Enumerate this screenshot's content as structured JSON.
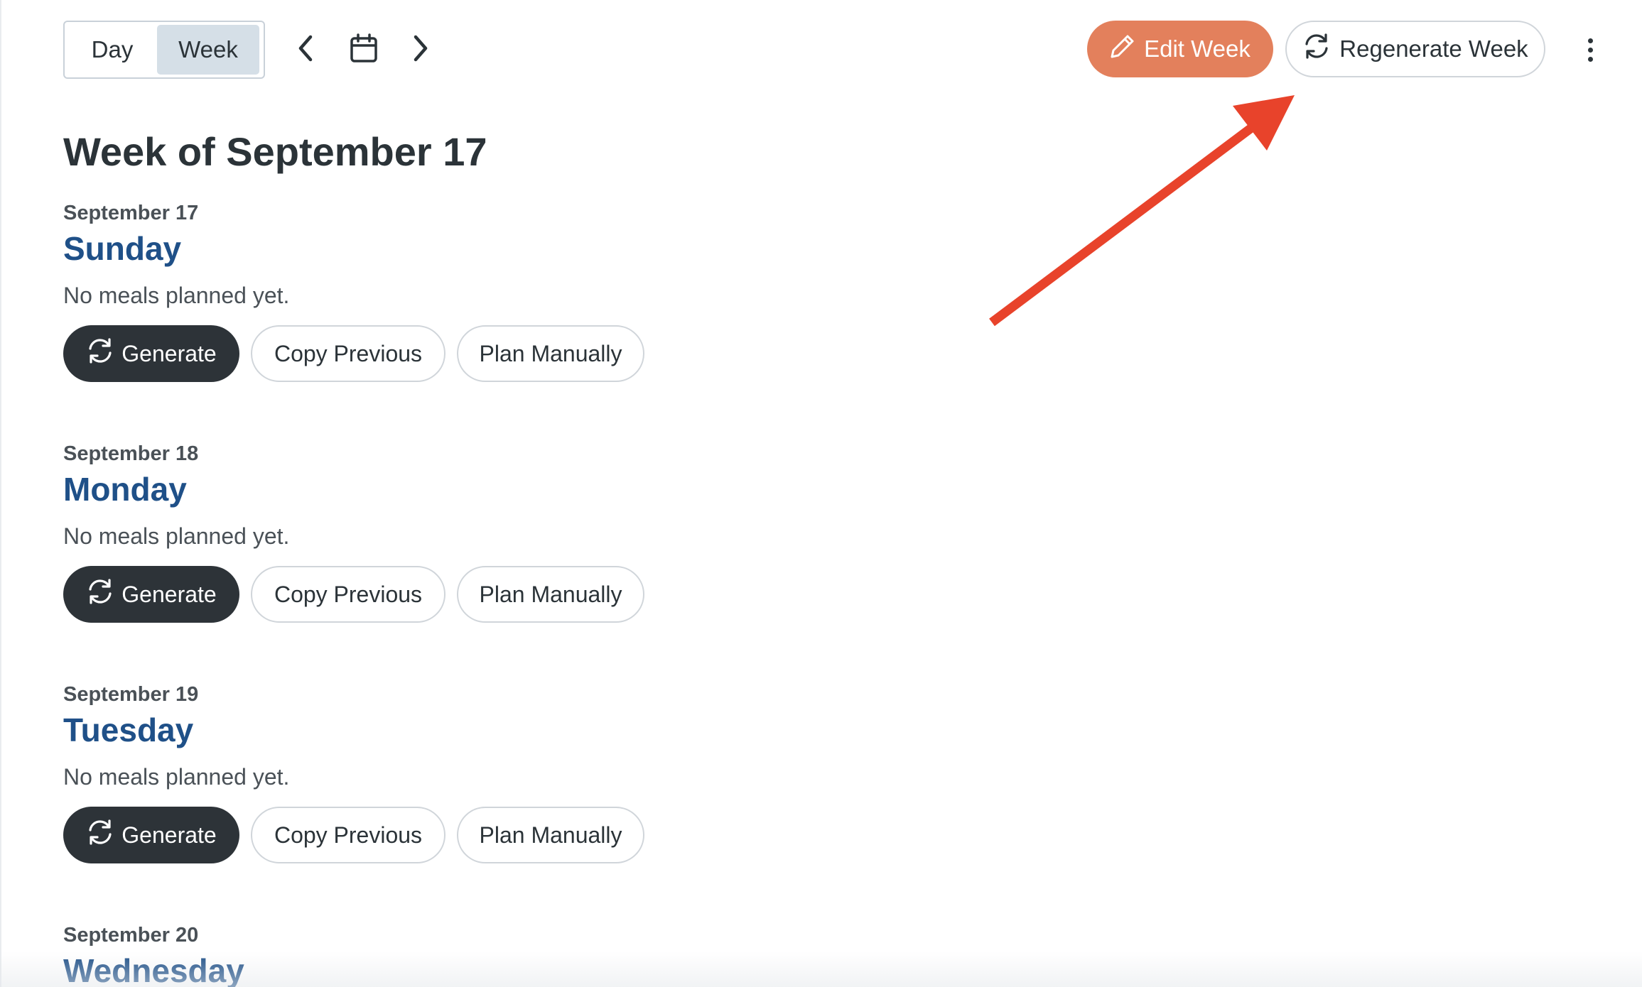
{
  "toolbar": {
    "view_toggle": {
      "day_label": "Day",
      "week_label": "Week",
      "selected": "Week"
    },
    "icons": {
      "prev": "chevron-left-icon",
      "calendar": "calendar-icon",
      "next": "chevron-right-icon",
      "more": "more-vertical-icon"
    },
    "edit_week_label": "Edit Week",
    "regenerate_week_label": "Regenerate Week",
    "colors": {
      "edit_week_bg": "#e3805c",
      "annotation_arrow": "#e8432b"
    }
  },
  "page_title": "Week of September 17",
  "days": [
    {
      "date": "September 17",
      "name": "Sunday",
      "empty_text": "No meals planned yet.",
      "actions": {
        "generate": "Generate",
        "copy_previous": "Copy Previous",
        "plan_manually": "Plan Manually"
      }
    },
    {
      "date": "September 18",
      "name": "Monday",
      "empty_text": "No meals planned yet.",
      "actions": {
        "generate": "Generate",
        "copy_previous": "Copy Previous",
        "plan_manually": "Plan Manually"
      }
    },
    {
      "date": "September 19",
      "name": "Tuesday",
      "empty_text": "No meals planned yet.",
      "actions": {
        "generate": "Generate",
        "copy_previous": "Copy Previous",
        "plan_manually": "Plan Manually"
      }
    },
    {
      "date": "September 20",
      "name": "Wednesday"
    }
  ]
}
